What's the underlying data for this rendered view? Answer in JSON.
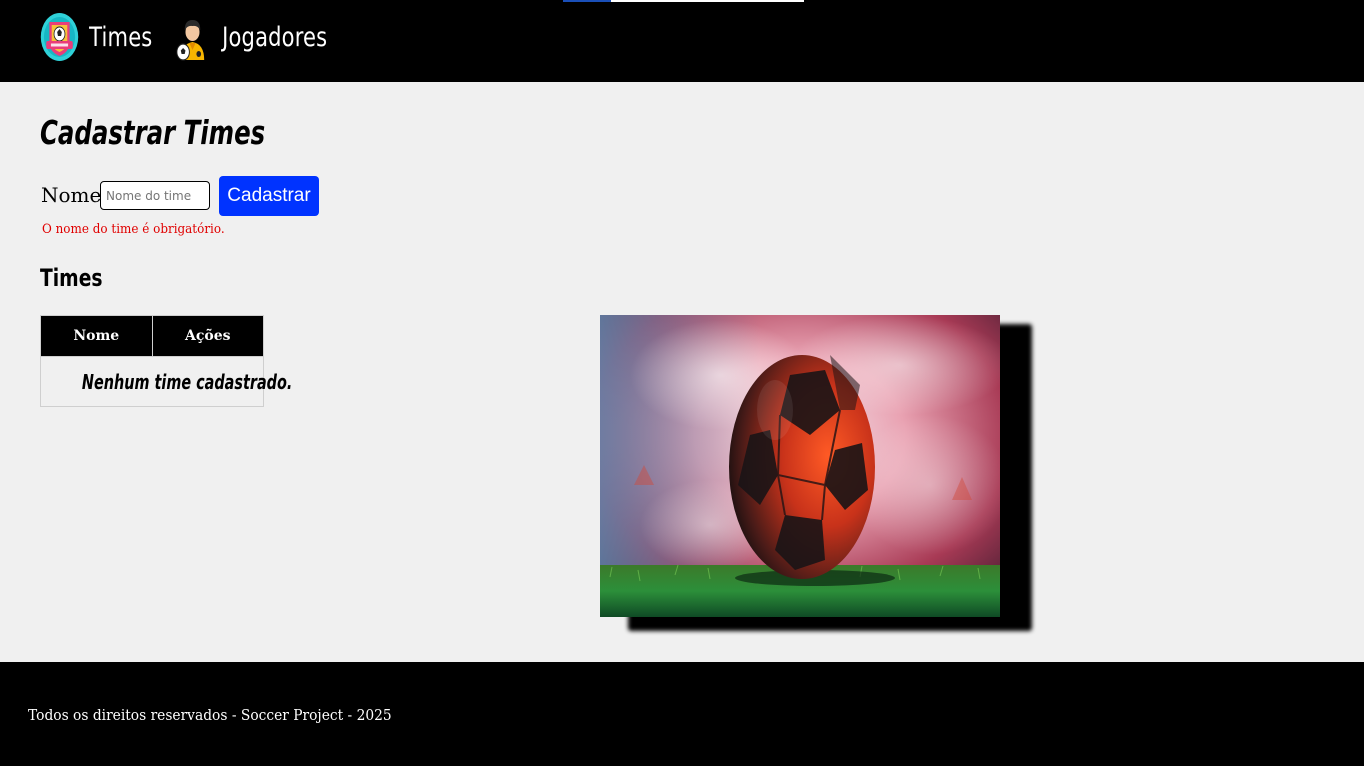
{
  "nav": {
    "items": [
      {
        "label": "Times",
        "icon": "soccer-badge-icon"
      },
      {
        "label": "Jogadores",
        "icon": "soccer-player-icon"
      }
    ]
  },
  "form": {
    "title": "Cadastrar Times",
    "name_label": "Nome",
    "name_placeholder": "Nome do time",
    "name_value": "",
    "submit_label": "Cadastrar",
    "error": "O nome do time é obrigatório."
  },
  "teams": {
    "title": "Times",
    "columns": [
      "Nome",
      "Ações"
    ],
    "rows": [],
    "empty_text": "Nenhum time cadastrado."
  },
  "hero": {
    "image": "soccer-ball-on-grass-illustration"
  },
  "footer": {
    "text": "Todos os direitos reservados - Soccer Project - 2025"
  },
  "colors": {
    "header_bg": "#000000",
    "page_bg": "#f0f0f0",
    "accent": "#0033ff",
    "error": "#e00000"
  }
}
